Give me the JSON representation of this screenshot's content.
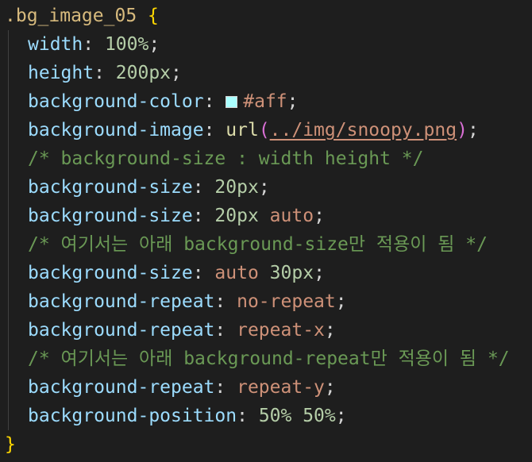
{
  "code": {
    "selector": ".bg_image_05",
    "open_brace": "{",
    "close_brace": "}",
    "lines": [
      {
        "prop": "width",
        "value": "100%"
      },
      {
        "prop": "height",
        "value": "200px"
      },
      {
        "prop": "background-color",
        "value": "#aff",
        "swatch": "#aaffff"
      },
      {
        "prop": "background-image",
        "func": "url",
        "arg": "../img/snoopy.png"
      },
      {
        "comment": "/* background-size : width height */"
      },
      {
        "prop": "background-size",
        "value": "20px"
      },
      {
        "prop": "background-size",
        "num": "20px",
        "kw": "auto"
      },
      {
        "comment": "/* 여기서는 아래 background-size만 적용이 됨 */"
      },
      {
        "prop": "background-size",
        "kw": "auto",
        "num": "30px"
      },
      {
        "prop": "background-repeat",
        "value": "no-repeat"
      },
      {
        "prop": "background-repeat",
        "value": "repeat-x"
      },
      {
        "comment": "/* 여기서는 아래 background-repeat만 적용이 됨 */"
      },
      {
        "prop": "background-repeat",
        "value": "repeat-y"
      },
      {
        "prop": "background-position",
        "value": "50% 50%"
      }
    ]
  },
  "colors": {
    "background": "#1e1e1e",
    "selector": "#d7ba7d",
    "brace": "#ffd700",
    "property": "#9cdcfe",
    "number": "#b5cea8",
    "string_value": "#ce9178",
    "function": "#dcdcaa",
    "comment": "#6a9955"
  }
}
